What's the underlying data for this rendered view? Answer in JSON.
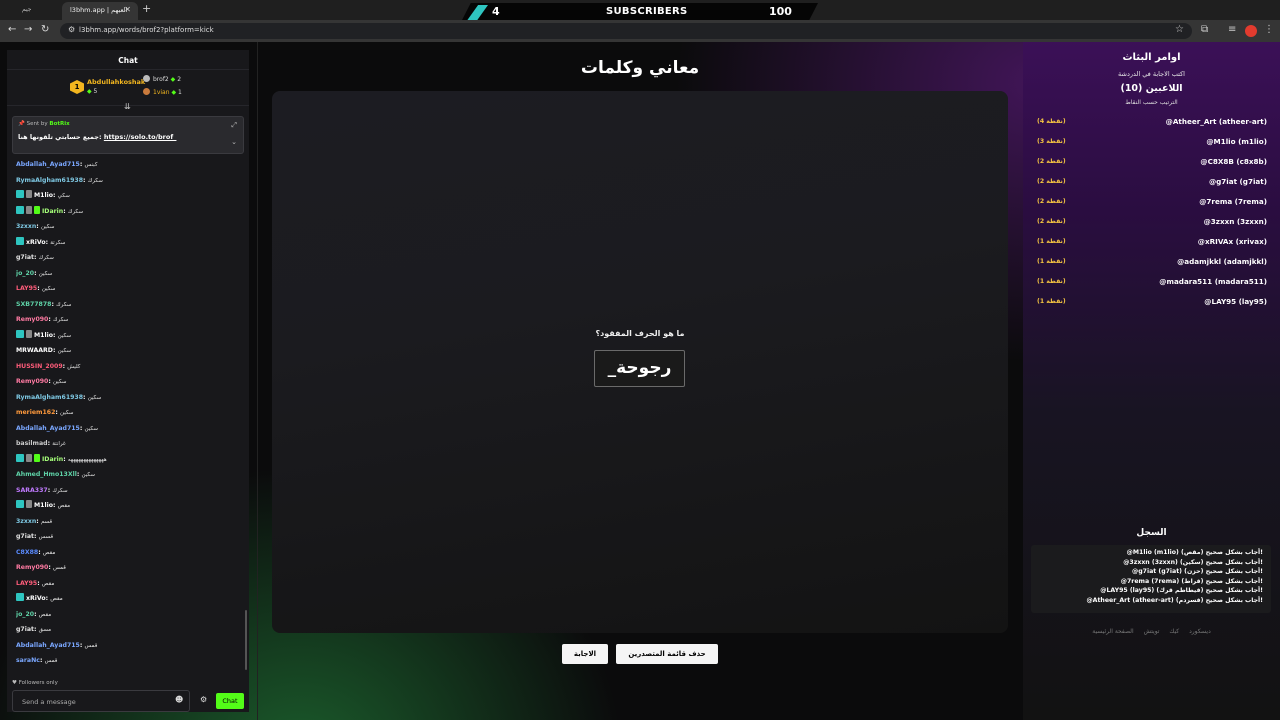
{
  "browser": {
    "tab_inactive": "جيم",
    "tab_active": "l3bhm.app | العبهم",
    "url": "l3bhm.app/words/brof2?platform=kick"
  },
  "banner": {
    "left_value": "4",
    "label": "SUBSCRIBERS",
    "right_value": "100"
  },
  "chat": {
    "header": "Chat",
    "top": [
      {
        "rank": "1",
        "name": "Abdullahkoshak",
        "count": "5"
      },
      {
        "name": "brof2",
        "count": "2"
      },
      {
        "name": "1vian",
        "count": "1"
      }
    ],
    "pinned": {
      "sent_by_label": "Sent by",
      "bot": "BotRix",
      "message": "جميع حسابتي تلقونها هنا:",
      "link": "https://solo.to/brof_"
    },
    "messages": [
      {
        "user": "Abdallah_Ayad715",
        "text": "كبنس",
        "color": "#7aa7ff",
        "badges": []
      },
      {
        "user": "RymaAlgham61938",
        "text": "سكرك",
        "color": "#7ec8e3",
        "badges": []
      },
      {
        "user": "M1lio",
        "text": "سكي",
        "color": "#ffffff",
        "badges": [
          "sub",
          "mod"
        ]
      },
      {
        "user": "IDarin",
        "text": "سكرك",
        "color": "#a6ff7a",
        "badges": [
          "sub",
          "mod",
          "g"
        ]
      },
      {
        "user": "3zxxn",
        "text": "سكين",
        "color": "#7ec8e3",
        "badges": []
      },
      {
        "user": "xRiVo",
        "text": "سكرتة",
        "color": "#ffffff",
        "badges": [
          "sub"
        ]
      },
      {
        "user": "g7iat",
        "text": "سكرك",
        "color": "#e6e6e6",
        "badges": []
      },
      {
        "user": "jo_20",
        "text": "سكين",
        "color": "#5fd3a8",
        "badges": []
      },
      {
        "user": "LAY95",
        "text": "سكين",
        "color": "#ff5c7a",
        "badges": []
      },
      {
        "user": "SXB77878",
        "text": "سكرك",
        "color": "#5fd3a8",
        "badges": []
      },
      {
        "user": "Remy090",
        "text": "سكرك",
        "color": "#ff7aa2",
        "badges": []
      },
      {
        "user": "M1lio",
        "text": "سكين",
        "color": "#ffffff",
        "badges": [
          "sub",
          "mod"
        ]
      },
      {
        "user": "MRWAARD",
        "text": "سكين",
        "color": "#ffffff",
        "badges": []
      },
      {
        "user": "HUSSIN_2009",
        "text": "كليش",
        "color": "#ff5c7a",
        "badges": []
      },
      {
        "user": "Remy090",
        "text": "سكين",
        "color": "#ff7aa2",
        "badges": []
      },
      {
        "user": "RymaAlgham61938",
        "text": "سكين",
        "color": "#7ec8e3",
        "badges": []
      },
      {
        "user": "meriem162",
        "text": "سكين",
        "color": "#ff9a3c",
        "badges": []
      },
      {
        "user": "Abdallah_Ayad715",
        "text": "سكين",
        "color": "#7aa7ff",
        "badges": []
      },
      {
        "user": "basilmad",
        "text": "غرانتة",
        "color": "#cccccc",
        "badges": []
      },
      {
        "user": "IDarin",
        "text": "ههههههههههههههه",
        "color": "#a6ff7a",
        "badges": [
          "sub",
          "mod",
          "g"
        ]
      },
      {
        "user": "Ahmed_Hmo13Xll",
        "text": "سكين",
        "color": "#5fd3a8",
        "badges": []
      },
      {
        "user": "SARA337",
        "text": "سكرك",
        "color": "#c07aff",
        "badges": []
      },
      {
        "user": "M1lio",
        "text": "مقص",
        "color": "#ffffff",
        "badges": [
          "sub",
          "mod"
        ]
      },
      {
        "user": "3zxxn",
        "text": "قسم",
        "color": "#7ec8e3",
        "badges": []
      },
      {
        "user": "g7iat",
        "text": "قسس",
        "color": "#e6e6e6",
        "badges": []
      },
      {
        "user": "C8X88",
        "text": "مقص",
        "color": "#5a8bff",
        "badges": []
      },
      {
        "user": "Remy090",
        "text": "قمس",
        "color": "#ff7aa2",
        "badges": []
      },
      {
        "user": "LAY95",
        "text": "مقص",
        "color": "#ff5c7a",
        "badges": []
      },
      {
        "user": "xRiVo",
        "text": "مقص",
        "color": "#ffffff",
        "badges": [
          "sub"
        ]
      },
      {
        "user": "jo_20",
        "text": "مقص",
        "color": "#5fd3a8",
        "badges": []
      },
      {
        "user": "g7iat",
        "text": "مسق",
        "color": "#e6e6e6",
        "badges": []
      },
      {
        "user": "Abdallah_Ayad715",
        "text": "قمس",
        "color": "#7aa7ff",
        "badges": []
      },
      {
        "user": "saraNc",
        "text": "قمس",
        "color": "#7aa7ff",
        "badges": []
      }
    ],
    "followers_only": "Followers only",
    "input_placeholder": "Send a message",
    "send_label": "Chat"
  },
  "main": {
    "title": "معاني وكلمات",
    "question": "ما هو الحرف المفقود؟",
    "word": "_رجوحة",
    "answer_button": "الاجابة",
    "clear_button": "حذف قائمة المتصدرين"
  },
  "right": {
    "title": "اوامر البثاث",
    "subtitle": "اكتب الاجابة في الدردشة",
    "players": "اللاعبين (10)",
    "sort": "الترتيب حسب النقاط",
    "leaderboard": [
      {
        "name": "@Atheer_Art (atheer-art)",
        "points": "(4 نقطة)"
      },
      {
        "name": "@M1lio (m1lio)",
        "points": "(3 نقطة)"
      },
      {
        "name": "@C8X8B (c8x8b)",
        "points": "(2 نقطة)"
      },
      {
        "name": "@g7iat (g7iat)",
        "points": "(2 نقطة)"
      },
      {
        "name": "@7rema (7rema)",
        "points": "(2 نقطة)"
      },
      {
        "name": "@3zxxn (3zxxn)",
        "points": "(2 نقطة)"
      },
      {
        "name": "@xRIVAx (xrivax)",
        "points": "(1 نقطة)"
      },
      {
        "name": "@adamjkkl (adamjkkl)",
        "points": "(1 نقطة)"
      },
      {
        "name": "@madara511 (madara511)",
        "points": "(1 نقطة)"
      },
      {
        "name": "@LAY95 (lay95)",
        "points": "(1 نقطة)"
      }
    ],
    "log_title": "السجل",
    "log": [
      "@M1lio (m1lio) أجاب بشكل صحيح (مقص)!",
      "@3zxxn (3zxxn) أجاب بشكل صحيح (سكين)!",
      "@g7iat (g7iat) أجاب بشكل صحيح (حزن)!",
      "@7rema (7rema) أجاب بشكل صحيح (قراط)!",
      "@LAY95 (lay95) أجاب بشكل صحيح (قيطاطم قرك)!",
      "@Atheer_Art (atheer-art) أجاب بشكل صحيح (قسردم)!"
    ],
    "footer": [
      "الصفحة الرئيسية",
      "تويتش",
      "كيك",
      "ديسكورد"
    ]
  }
}
